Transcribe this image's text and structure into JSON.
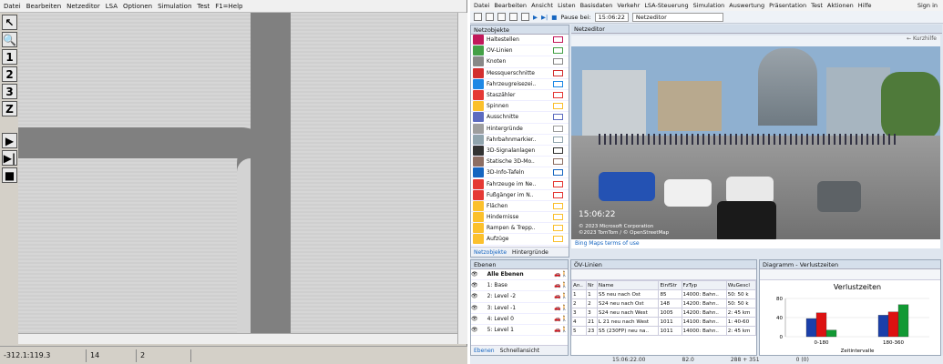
{
  "left": {
    "menu": [
      "Datei",
      "Bearbeiten",
      "Netzeditor",
      "LSA",
      "Optionen",
      "Simulation",
      "Test",
      "F1=Help"
    ],
    "tools": [
      "↖",
      "🔍",
      "1",
      "2",
      "3",
      "Z",
      "▶",
      "▶|",
      "■"
    ],
    "status": [
      "-312.1:119.3",
      "14",
      "2"
    ]
  },
  "right": {
    "menu": [
      "Datei",
      "Bearbeiten",
      "Ansicht",
      "Listen",
      "Basisdaten",
      "Verkehr",
      "LSA-Steuerung",
      "Simulation",
      "Auswertung",
      "Präsentation",
      "Test",
      "Aktionen",
      "Hilfe"
    ],
    "sign_in": "Sign in",
    "toolbar": {
      "pause_label": "Pause bei:",
      "pause_time": "15:06:22",
      "mode": "Netzeditor"
    },
    "netzobjekte": {
      "title": "Netzobjekte",
      "items": [
        {
          "label": "Haltestellen",
          "color": "#c2185b"
        },
        {
          "label": "ÖV-Linien",
          "color": "#43a047"
        },
        {
          "label": "Knoten",
          "color": "#888888"
        },
        {
          "label": "Messquerschnitte",
          "color": "#d32f2f"
        },
        {
          "label": "Fahrzeugreisezei..",
          "color": "#1e88e5"
        },
        {
          "label": "Staszähler",
          "color": "#e53935"
        },
        {
          "label": "Spinnen",
          "color": "#fbc02d"
        },
        {
          "label": "Ausschnitte",
          "color": "#5c6bc0"
        },
        {
          "label": "Hintergründe",
          "color": "#9e9e9e"
        },
        {
          "label": "Fahrbahnmarkier..",
          "color": "#90a4ae"
        },
        {
          "label": "3D-Signalanlagen",
          "color": "#333333"
        },
        {
          "label": "Statische 3D-Mo..",
          "color": "#8d6e63"
        },
        {
          "label": "3D-Info-Tafeln",
          "color": "#1565c0"
        },
        {
          "label": "Fahrzeuge im Ne..",
          "color": "#e53935"
        },
        {
          "label": "Fußgänger im N..",
          "color": "#e53935"
        },
        {
          "label": "Flächen",
          "color": "#fbc02d"
        },
        {
          "label": "Hindernisse",
          "color": "#fbc02d"
        },
        {
          "label": "Rampen & Trepp..",
          "color": "#fbc02d"
        },
        {
          "label": "Aufzüge",
          "color": "#fbc02d"
        }
      ],
      "tabs": [
        "Netzobjekte",
        "Hintergründe"
      ]
    },
    "netzeditor": {
      "title": "Netzeditor",
      "back_label": "← Kurzhilfe",
      "time": "15:06:22",
      "copyright1": "© 2023 Microsoft Corporation",
      "copyright2": "©2023 TomTom / © OpenStreetMap",
      "bing_terms": "Bing Maps terms of use"
    },
    "ebenen": {
      "title": "Ebenen",
      "rows": [
        "Alle Ebenen",
        "1: Base",
        "2: Level -2",
        "3: Level -1",
        "4: Level 0",
        "5: Level 1"
      ],
      "tabs": [
        "Ebenen",
        "Schnellansicht"
      ]
    },
    "oev": {
      "title": "ÖV-Linien",
      "headers": [
        "An..",
        "Nr",
        "Name",
        "EinfStr",
        "FzTyp",
        "WuGescl"
      ],
      "rows": [
        [
          "1",
          "1",
          "S5 neu nach Ost",
          "85",
          "14000: Bahn..",
          "50: 50 k"
        ],
        [
          "2",
          "2",
          "S24 neu nach Ost",
          "148",
          "14200: Bahn..",
          "50: 50 k"
        ],
        [
          "3",
          "3",
          "S24 neu nach West",
          "1005",
          "14200: Bahn..",
          "2: 45 km"
        ],
        [
          "4",
          "21",
          "L 21 neu nach West",
          "1011",
          "14100: Bahn..",
          "1: 40-60"
        ],
        [
          "5",
          "23",
          "S5 (230FP) neu na..",
          "1011",
          "14000: Bahn..",
          "2: 45 km"
        ]
      ]
    },
    "diagramm": {
      "title": "Diagramm - Verlustzeiten"
    },
    "status": [
      "15:06:22.00",
      "82.0",
      "288 + 351",
      "0 (0)"
    ]
  },
  "chart_data": {
    "type": "bar",
    "title": "Verlustzeiten",
    "xlabel": "Zeitintervalle",
    "ylabel": "",
    "categories": [
      "0-180",
      "180-360"
    ],
    "series": [
      {
        "color": "#1a3faa",
        "values": [
          38,
          45
        ]
      },
      {
        "color": "#d11",
        "values": [
          50,
          52
        ]
      },
      {
        "color": "#119933",
        "values": [
          14,
          67
        ]
      }
    ],
    "ylim": [
      0,
      80
    ],
    "yticks": [
      0,
      40,
      80
    ]
  }
}
